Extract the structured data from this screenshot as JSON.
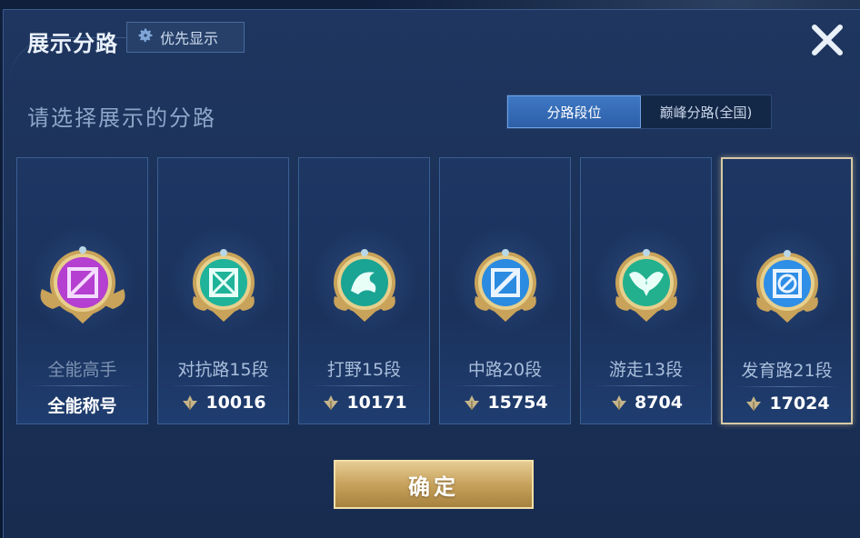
{
  "dialog": {
    "title": "展示分路",
    "priority_button": "优先显示",
    "subtitle": "请选择展示的分路",
    "tabs": [
      {
        "label": "分路段位",
        "active": true
      },
      {
        "label": "巅峰分路(全国)",
        "active": false
      }
    ],
    "confirm_label": "确定"
  },
  "cards": [
    {
      "role": "全能高手",
      "value": "全能称号",
      "icon": "all-round-emblem-icon",
      "color": "#b53fd0",
      "selected": false
    },
    {
      "role": "对抗路15段",
      "value": "10016",
      "icon": "clash-lane-emblem-icon",
      "color": "#1fb39a",
      "selected": false
    },
    {
      "role": "打野15段",
      "value": "10171",
      "icon": "jungle-dragon-emblem-icon",
      "color": "#1aa494",
      "selected": false
    },
    {
      "role": "中路20段",
      "value": "15754",
      "icon": "mid-lane-emblem-icon",
      "color": "#2b8be0",
      "selected": false
    },
    {
      "role": "游走13段",
      "value": "8704",
      "icon": "roam-wings-emblem-icon",
      "color": "#22b08e",
      "selected": false
    },
    {
      "role": "发育路21段",
      "value": "17024",
      "icon": "farm-lane-emblem-icon",
      "color": "#2f8ee6",
      "selected": true
    }
  ]
}
